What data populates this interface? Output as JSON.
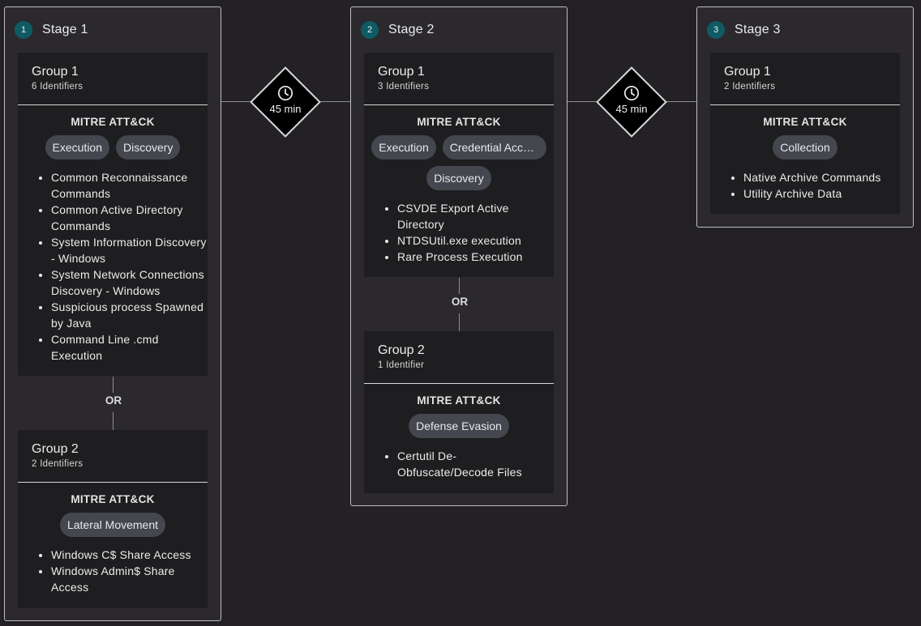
{
  "mitre_title": "MITRE ATT&CK",
  "or_label": "OR",
  "delays": [
    {
      "label": "45 min",
      "icon": "clock-icon"
    },
    {
      "label": "45 min",
      "icon": "clock-icon"
    }
  ],
  "stages": [
    {
      "number": "1",
      "title": "Stage 1",
      "groups": [
        {
          "title": "Group 1",
          "count": "6 Identifiers",
          "tactics": [
            "Execution",
            "Discovery"
          ],
          "identifiers": [
            "Common Reconnaissance Commands",
            "Common Active Directory Commands",
            "System Information Discovery - Windows",
            "System Network Connections Discovery - Windows",
            "Suspicious process Spawned by Java",
            "Command Line .cmd Execution"
          ]
        },
        {
          "title": "Group 2",
          "count": "2 Identifiers",
          "tactics": [
            "Lateral Movement"
          ],
          "identifiers": [
            "Windows C$ Share Access",
            "Windows Admin$ Share Access"
          ]
        }
      ]
    },
    {
      "number": "2",
      "title": "Stage 2",
      "groups": [
        {
          "title": "Group 1",
          "count": "3 Identifiers",
          "tactics": [
            "Execution",
            "Credential Acce…",
            "Discovery"
          ],
          "identifiers": [
            "CSVDE Export Active Directory",
            "NTDSUtil.exe execution",
            "Rare Process Execution"
          ]
        },
        {
          "title": "Group 2",
          "count": "1 Identifier",
          "tactics": [
            "Defense Evasion"
          ],
          "identifiers": [
            "Certutil De-Obfuscate/Decode Files"
          ]
        }
      ]
    },
    {
      "number": "3",
      "title": "Stage 3",
      "groups": [
        {
          "title": "Group 1",
          "count": "2 Identifiers",
          "tactics": [
            "Collection"
          ],
          "identifiers": [
            "Native Archive Commands",
            "Utility Archive Data"
          ]
        }
      ]
    }
  ]
}
